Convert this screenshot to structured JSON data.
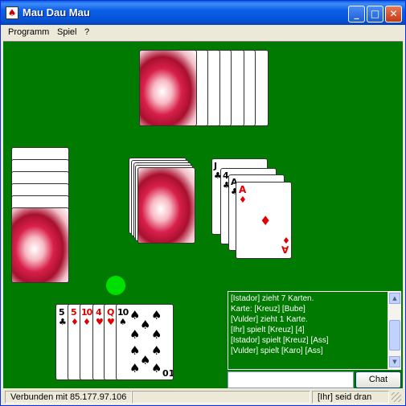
{
  "window": {
    "title": "Mau Dau Mau",
    "buttons": {
      "minimize": "_",
      "maximize": "□",
      "close": "✕"
    }
  },
  "menu": {
    "items": [
      "Programm",
      "Spiel",
      "?"
    ]
  },
  "hand": {
    "cards": [
      {
        "rank": "5",
        "suit": "♣",
        "color": "black"
      },
      {
        "rank": "5",
        "suit": "♦",
        "color": "red"
      },
      {
        "rank": "10",
        "suit": "♦",
        "color": "red"
      },
      {
        "rank": "4",
        "suit": "♥",
        "color": "red"
      },
      {
        "rank": "Q",
        "suit": "♥",
        "color": "red"
      },
      {
        "rank": "10",
        "suit": "♠",
        "color": "black"
      }
    ],
    "face_card": {
      "rank": "10",
      "rank_bottom": "01",
      "suit": "♠"
    }
  },
  "discard": {
    "cards": [
      {
        "rank": "J",
        "suit": "♣",
        "color": "black"
      },
      {
        "rank": "4",
        "suit": "♣",
        "color": "black"
      },
      {
        "rank": "A",
        "suit": "♣",
        "color": "black"
      }
    ],
    "top": {
      "rank": "A",
      "rank_bottom": "∀",
      "suit": "♦",
      "color": "red"
    }
  },
  "chat": {
    "lines": [
      "[Istador] zieht 7 Karten.",
      "Karte: [Kreuz] [Bube]",
      "[Vulder] zieht 1 Karte.",
      "[Ihr] spielt [Kreuz] [4]",
      "[Istador] spielt [Kreuz] [Ass]",
      "[Vulder] spielt [Karo] [Ass]"
    ],
    "input_value": "",
    "send_label": "Chat"
  },
  "status": {
    "connection": "Verbunden mit 85.177.97.106",
    "turn": "[Ihr] seid dran"
  },
  "colors": {
    "felt": "#007a00",
    "turn_indicator": "#00e000"
  }
}
